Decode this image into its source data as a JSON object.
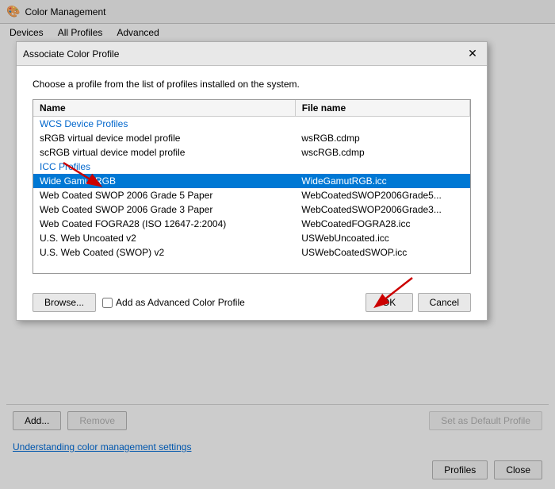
{
  "window": {
    "title": "Color Management",
    "icon": "🎨"
  },
  "menu": {
    "items": [
      "Devices",
      "All Profiles",
      "Advanced"
    ]
  },
  "main_buttons": {
    "add": "Add...",
    "remove": "Remove",
    "set_default": "Set as Default Profile",
    "profiles": "Profiles",
    "close": "Close"
  },
  "link": {
    "text": "Understanding color management settings"
  },
  "dialog": {
    "title": "Associate Color Profile",
    "close_label": "✕",
    "description": "Choose a profile from the list of profiles installed on the system.",
    "table": {
      "col_name": "Name",
      "col_filename": "File name",
      "rows": [
        {
          "type": "category",
          "name": "WCS Device Profiles",
          "filename": ""
        },
        {
          "type": "data",
          "name": "sRGB virtual device model profile",
          "filename": "wsRGB.cdmp"
        },
        {
          "type": "data",
          "name": "scRGB virtual device model profile",
          "filename": "wscRGB.cdmp"
        },
        {
          "type": "category",
          "name": "ICC Profiles",
          "filename": ""
        },
        {
          "type": "selected",
          "name": "Wide Gamut RGB",
          "filename": "WideGamutRGB.icc"
        },
        {
          "type": "data",
          "name": "Web Coated SWOP 2006 Grade 5 Paper",
          "filename": "WebCoatedSWOP2006Grade5..."
        },
        {
          "type": "data",
          "name": "Web Coated SWOP 2006 Grade 3 Paper",
          "filename": "WebCoatedSWOP2006Grade3..."
        },
        {
          "type": "data",
          "name": "Web Coated FOGRA28 (ISO 12647-2:2004)",
          "filename": "WebCoatedFOGRA28.icc"
        },
        {
          "type": "data",
          "name": "U.S. Web Uncoated v2",
          "filename": "USWebUncoated.icc"
        },
        {
          "type": "data",
          "name": "U.S. Web Coated (SWOP) v2",
          "filename": "USWebCoatedSWOP.icc"
        }
      ]
    },
    "footer": {
      "browse": "Browse...",
      "checkbox_label": "Add as Advanced Color Profile",
      "ok": "OK",
      "cancel": "Cancel"
    }
  }
}
